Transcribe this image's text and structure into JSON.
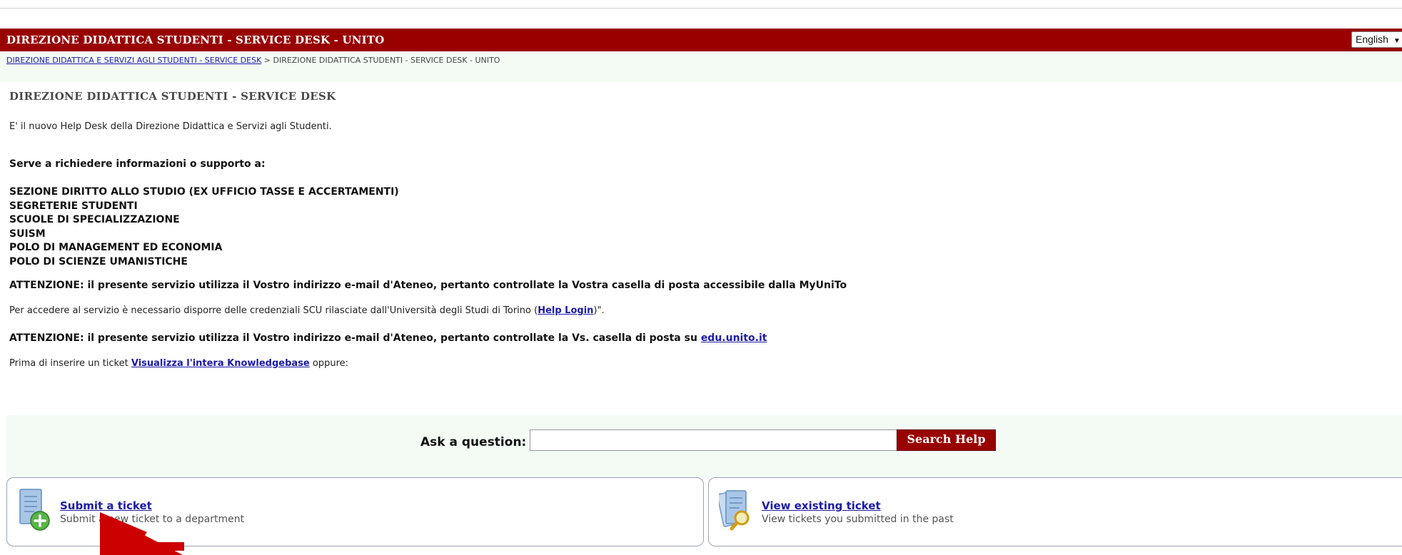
{
  "header": {
    "title": "DIREZIONE DIDATTICA STUDENTI - SERVICE DESK - UNITO",
    "language": "English",
    "brand_color": "#990000"
  },
  "breadcrumb": {
    "link": "DIREZIONE DIDATTICA E SERVIZI AGLI STUDENTI - SERVICE DESK",
    "separator": ">",
    "current": "DIREZIONE DIDATTICA STUDENTI - SERVICE DESK - UNITO"
  },
  "main": {
    "heading": "DIREZIONE DIDATTICA STUDENTI - SERVICE DESK",
    "intro": "E' il nuovo Help Desk della Direzione Didattica e Servizi agli Studenti.",
    "serve_label": "Serve a richiedere informazioni o supporto a:",
    "units": [
      "SEZIONE DIRITTO ALLO STUDIO (EX UFFICIO TASSE E ACCERTAMENTI)",
      "SEGRETERIE STUDENTI",
      "SCUOLE DI SPECIALIZZAZIONE",
      "SUISM",
      "POLO DI MANAGEMENT ED ECONOMIA",
      "POLO DI SCIENZE UMANISTICHE"
    ],
    "attention_1": "ATTENZIONE: il presente servizio utilizza il Vostro indirizzo e-mail d'Ateneo, pertanto controllate la Vostra casella di posta accessibile dalla MyUniTo",
    "access_prefix": "Per accedere al servizio è necessario disporre delle credenziali SCU rilasciate dall'Università degli Studi di Torino (",
    "access_link": "Help Login",
    "access_suffix": ")\".",
    "attention_2_prefix": "ATTENZIONE: il presente servizio utilizza il Vostro indirizzo e-mail d'Ateneo, pertanto controllate la Vs. casella di posta su ",
    "attention_2_link": "edu.unito.it",
    "before_prefix": "Prima di inserire un ticket ",
    "before_link": "Visualizza l'intera Knowledgebase",
    "before_suffix": " oppure:"
  },
  "search": {
    "label": "Ask a question:",
    "value": "",
    "button": "Search Help"
  },
  "cards": [
    {
      "title": "Submit a ticket",
      "description": "Submit a new ticket to a department",
      "icon": "document-add-icon"
    },
    {
      "title": "View existing ticket",
      "description": "View tickets you submitted in the past",
      "icon": "document-search-icon"
    }
  ],
  "annotation": {
    "icon": "red-arrow-icon",
    "color": "#cc0000"
  }
}
